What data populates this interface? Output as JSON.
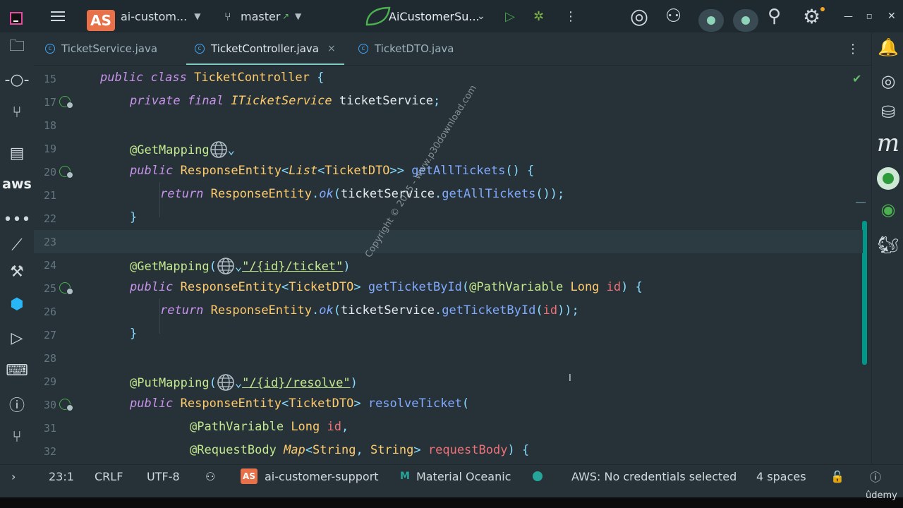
{
  "topbar": {
    "project_badge": "AS",
    "project_name": "ai-custom...",
    "branch_name": "master",
    "branch_arrow": "↗",
    "run_config": "AiCustomerSu...",
    "icons": [
      "hamburger-menu-icon",
      "branch-icon",
      "run-icon",
      "debug-icon",
      "more-icon",
      "ai-assistant-icon",
      "profile-icon",
      "search-icon",
      "settings-icon"
    ]
  },
  "tabs": [
    {
      "label": "TicketService.java"
    },
    {
      "label": "TicketController.java",
      "close": "×"
    },
    {
      "label": "TicketDTO.java"
    }
  ],
  "editor": {
    "lines": [
      {
        "n": "15"
      },
      {
        "n": "17"
      },
      {
        "n": "18"
      },
      {
        "n": "19"
      },
      {
        "n": "20"
      },
      {
        "n": "21"
      },
      {
        "n": "22"
      },
      {
        "n": "23"
      },
      {
        "n": "24"
      },
      {
        "n": "25"
      },
      {
        "n": "26"
      },
      {
        "n": "27"
      },
      {
        "n": "28"
      },
      {
        "n": "29"
      },
      {
        "n": "30"
      },
      {
        "n": "31"
      },
      {
        "n": "32"
      }
    ],
    "code": {
      "l15": {
        "kw1": "public",
        "kw2": "class",
        "cls": "TicketController",
        "brace": "{"
      },
      "l17": {
        "kw1": "private",
        "kw2": "final",
        "type": "ITicketService",
        "name": "ticketService",
        "end": ";"
      },
      "l19": {
        "ann": "@GetMapping"
      },
      "l20": {
        "kw": "public",
        "t1": "ResponseEntity",
        "p1": "<",
        "t2": "List",
        "p2": "<",
        "t3": "TicketDTO",
        "p3": ">>",
        "fn": "getAllTickets",
        "rest": "() {"
      },
      "l21": {
        "kw": "return",
        "t1": "ResponseEntity",
        "dot": ".",
        "m1": "ok",
        "o": "(",
        "v": "ticketService",
        "dot2": ".",
        "m2": "getAllTickets",
        "rest": "());"
      },
      "l22": {
        "b": "}"
      },
      "l24": {
        "ann": "@GetMapping",
        "open": "(",
        "str": "\"/{id}/ticket\"",
        "close": ")"
      },
      "l25": {
        "kw": "public",
        "t1": "ResponseEntity",
        "p1": "<",
        "t2": "TicketDTO",
        "p2": ">",
        "fn": "getTicketById",
        "o": "(",
        "ann": "@PathVariable",
        "t3": "Long",
        "id": "id",
        "rest": ") {"
      },
      "l26": {
        "kw": "return",
        "t1": "ResponseEntity",
        "dot": ".",
        "m1": "ok",
        "o": "(",
        "v": "ticketService",
        "dot2": ".",
        "m2": "getTicketById",
        "o2": "(",
        "id": "id",
        "rest": "));"
      },
      "l27": {
        "b": "}"
      },
      "l29": {
        "ann": "@PutMapping",
        "open": "(",
        "str": "\"/{id}/resolve\"",
        "close": ")"
      },
      "l30": {
        "kw": "public",
        "t1": "ResponseEntity",
        "p1": "<",
        "t2": "TicketDTO",
        "p2": ">",
        "fn": "resolveTicket",
        "rest": "("
      },
      "l31": {
        "ann": "@PathVariable",
        "t": "Long",
        "id": "id",
        "comma": ","
      },
      "l32": {
        "ann": "@RequestBody",
        "t1": "Map",
        "p1": "<",
        "t2": "String",
        "c": ", ",
        "t3": "String",
        "p2": ">",
        "id": "requestBody",
        "rest": ") {"
      }
    },
    "watermark": "Copyright © 2025 - www.p30download.com"
  },
  "status": {
    "position": "23:1",
    "line_sep": "CRLF",
    "encoding": "UTF-8",
    "project_badge": "AS",
    "project": "ai-customer-support",
    "theme_icon": "M",
    "theme": "Material Oceanic",
    "aws": "AWS: No credentials selected",
    "indent": "4 spaces",
    "expand": "›"
  },
  "overlay": {
    "brand": "ûdemy"
  }
}
